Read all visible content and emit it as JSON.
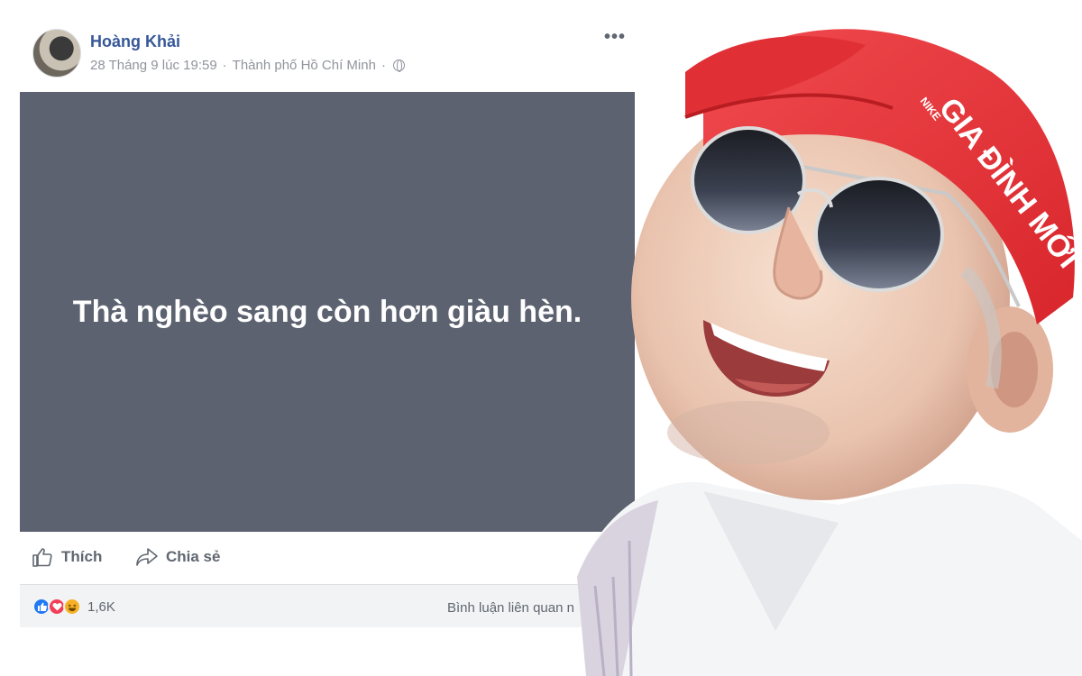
{
  "post": {
    "author": "Hoàng Khải",
    "date": "28 Tháng 9 lúc 19:59",
    "location": "Thành phố Hồ Chí Minh",
    "menu_glyph": "•••",
    "status_text": "Thà nghèo sang còn hơn giàu hèn.",
    "status_bg": "#5c6270"
  },
  "actions": {
    "like_label": "Thích",
    "share_label": "Chia sẻ"
  },
  "stats": {
    "reactions": [
      "like",
      "love",
      "haha"
    ],
    "reaction_count": "1,6K",
    "comments_label": "Bình luận liên quan n"
  },
  "photo": {
    "cap_text": "GIA ĐÌNH MỚI",
    "cap_brand": "NIKE",
    "cap_color": "#e8353a"
  },
  "colors": {
    "author_link": "#365899",
    "meta_text": "#90949c",
    "like_blue": "#2078f4",
    "love_red": "#f33e58",
    "haha_yellow": "#f7b125"
  }
}
